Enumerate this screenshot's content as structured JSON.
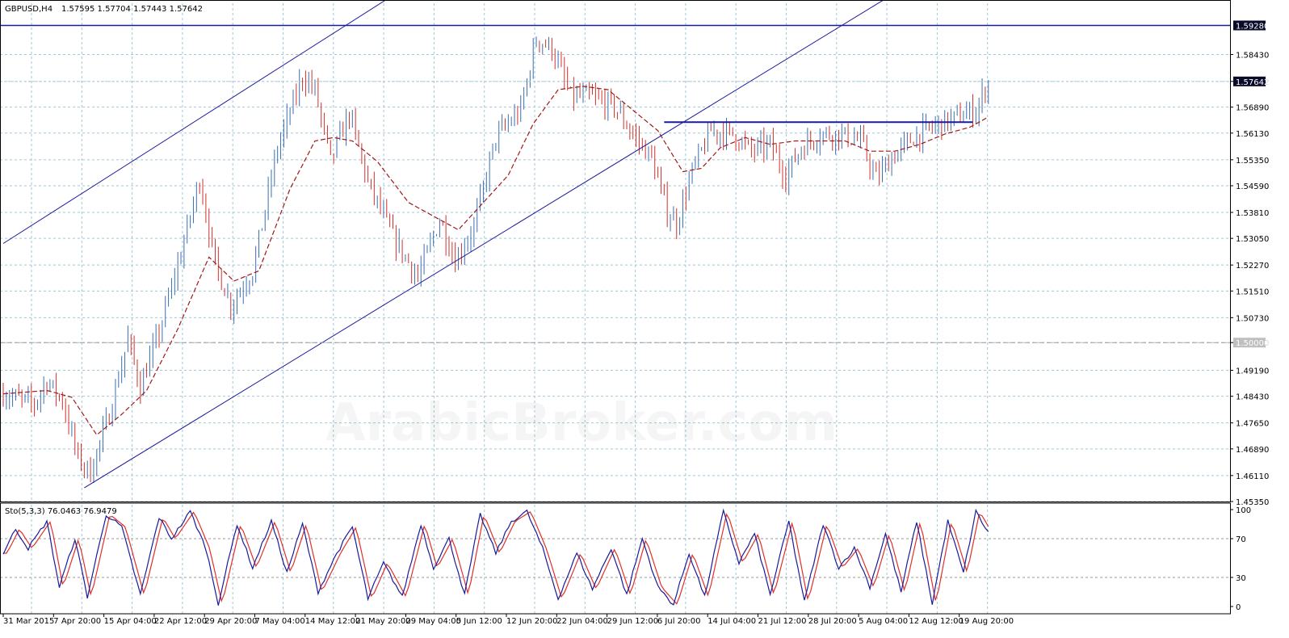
{
  "header": {
    "symbol": "GBPUSD,H4",
    "ohlc": "1.57595 1.57704 1.57443 1.57642"
  },
  "watermark": "ArabicBroker.com",
  "colors": {
    "bull": "#3b6fb0",
    "bear": "#d0312d",
    "ma": "#a01818",
    "trend": "#1a1a9c",
    "grid": "#9fc7d8",
    "stoch_main": "#1a1a9c",
    "stoch_signal": "#e0302a",
    "axis_tag_bg": "#0a0a2a",
    "axis_tag_text": "#ffffff"
  },
  "stochastic": {
    "label": "Sto(5,3,3) 76.0463 76.9479",
    "levels": [
      "100",
      "70",
      "30",
      "0"
    ]
  },
  "chart_data": {
    "type": "candlestick",
    "timeframe": "H4",
    "price_axis_labels": [
      "1.58430",
      "1.57642",
      "1.56890",
      "1.56130",
      "1.55350",
      "1.54590",
      "1.53810",
      "1.53050",
      "1.52270",
      "1.51510",
      "1.50730",
      "1.50000",
      "1.49190",
      "1.48430",
      "1.47650",
      "1.46890",
      "1.46110",
      "1.45350"
    ],
    "price_range": [
      1.4535,
      1.5993
    ],
    "time_axis_labels": [
      "31 Mar 2015",
      "7 Apr 20:00",
      "15 Apr 04:00",
      "22 Apr 12:00",
      "29 Apr 20:00",
      "7 May 04:00",
      "14 May 12:00",
      "21 May 20:00",
      "29 May 04:00",
      "5 Jun 12:00",
      "12 Jun 20:00",
      "22 Jun 04:00",
      "29 Jun 12:00",
      "6 Jul 20:00",
      "14 Jul 04:00",
      "21 Jul 12:00",
      "28 Jul 20:00",
      "5 Aug 04:00",
      "12 Aug 12:00",
      "19 Aug 20:00"
    ],
    "horizontal_levels": [
      {
        "value": 1.5928,
        "label": "1.59280"
      },
      {
        "value": 1.5,
        "label": "1.50000"
      },
      {
        "value": 1.57642,
        "label": "1.57642"
      }
    ],
    "resistance_segment": {
      "from_bar": 212,
      "to_bar": 311,
      "value": 1.5645
    },
    "channel_upper": [
      {
        "bar": 0,
        "value": 1.529
      },
      {
        "bar": 130,
        "value": 1.6045
      }
    ],
    "channel_lower": [
      {
        "bar": 26,
        "value": 1.4575
      },
      {
        "bar": 290,
        "value": 1.6045
      }
    ],
    "price_path": [
      {
        "bar": 0,
        "price": 1.485
      },
      {
        "bar": 10,
        "price": 1.482
      },
      {
        "bar": 14,
        "price": 1.489
      },
      {
        "bar": 19,
        "price": 1.483
      },
      {
        "bar": 24,
        "price": 1.466
      },
      {
        "bar": 28,
        "price": 1.462
      },
      {
        "bar": 34,
        "price": 1.479
      },
      {
        "bar": 40,
        "price": 1.501
      },
      {
        "bar": 44,
        "price": 1.487
      },
      {
        "bar": 50,
        "price": 1.503
      },
      {
        "bar": 57,
        "price": 1.526
      },
      {
        "bar": 63,
        "price": 1.548
      },
      {
        "bar": 68,
        "price": 1.523
      },
      {
        "bar": 73,
        "price": 1.511
      },
      {
        "bar": 80,
        "price": 1.521
      },
      {
        "bar": 88,
        "price": 1.557
      },
      {
        "bar": 96,
        "price": 1.578
      },
      {
        "bar": 100,
        "price": 1.574
      },
      {
        "bar": 105,
        "price": 1.553
      },
      {
        "bar": 111,
        "price": 1.567
      },
      {
        "bar": 117,
        "price": 1.547
      },
      {
        "bar": 125,
        "price": 1.531
      },
      {
        "bar": 133,
        "price": 1.519
      },
      {
        "bar": 140,
        "price": 1.536
      },
      {
        "bar": 145,
        "price": 1.524
      },
      {
        "bar": 151,
        "price": 1.534
      },
      {
        "bar": 158,
        "price": 1.56
      },
      {
        "bar": 166,
        "price": 1.568
      },
      {
        "bar": 171,
        "price": 1.589
      },
      {
        "bar": 176,
        "price": 1.586
      },
      {
        "bar": 182,
        "price": 1.572
      },
      {
        "bar": 188,
        "price": 1.572
      },
      {
        "bar": 196,
        "price": 1.569
      },
      {
        "bar": 202,
        "price": 1.561
      },
      {
        "bar": 208,
        "price": 1.554
      },
      {
        "bar": 213,
        "price": 1.538
      },
      {
        "bar": 216,
        "price": 1.535
      },
      {
        "bar": 221,
        "price": 1.55
      },
      {
        "bar": 227,
        "price": 1.562
      },
      {
        "bar": 234,
        "price": 1.561
      },
      {
        "bar": 240,
        "price": 1.556
      },
      {
        "bar": 246,
        "price": 1.558
      },
      {
        "bar": 251,
        "price": 1.549
      },
      {
        "bar": 256,
        "price": 1.557
      },
      {
        "bar": 262,
        "price": 1.561
      },
      {
        "bar": 268,
        "price": 1.561
      },
      {
        "bar": 275,
        "price": 1.559
      },
      {
        "bar": 280,
        "price": 1.548
      },
      {
        "bar": 285,
        "price": 1.554
      },
      {
        "bar": 292,
        "price": 1.56
      },
      {
        "bar": 300,
        "price": 1.564
      },
      {
        "bar": 306,
        "price": 1.566
      },
      {
        "bar": 312,
        "price": 1.568
      },
      {
        "bar": 316,
        "price": 1.5764
      }
    ],
    "moving_average_path": [
      {
        "bar": 0,
        "value": 1.485
      },
      {
        "bar": 14,
        "value": 1.486
      },
      {
        "bar": 22,
        "value": 1.484
      },
      {
        "bar": 30,
        "value": 1.473
      },
      {
        "bar": 38,
        "value": 1.479
      },
      {
        "bar": 46,
        "value": 1.486
      },
      {
        "bar": 56,
        "value": 1.504
      },
      {
        "bar": 66,
        "value": 1.525
      },
      {
        "bar": 74,
        "value": 1.518
      },
      {
        "bar": 82,
        "value": 1.521
      },
      {
        "bar": 92,
        "value": 1.545
      },
      {
        "bar": 100,
        "value": 1.559
      },
      {
        "bar": 106,
        "value": 1.56
      },
      {
        "bar": 112,
        "value": 1.559
      },
      {
        "bar": 120,
        "value": 1.553
      },
      {
        "bar": 130,
        "value": 1.541
      },
      {
        "bar": 138,
        "value": 1.537
      },
      {
        "bar": 146,
        "value": 1.533
      },
      {
        "bar": 154,
        "value": 1.541
      },
      {
        "bar": 162,
        "value": 1.549
      },
      {
        "bar": 170,
        "value": 1.564
      },
      {
        "bar": 178,
        "value": 1.574
      },
      {
        "bar": 186,
        "value": 1.575
      },
      {
        "bar": 194,
        "value": 1.574
      },
      {
        "bar": 202,
        "value": 1.568
      },
      {
        "bar": 210,
        "value": 1.562
      },
      {
        "bar": 218,
        "value": 1.55
      },
      {
        "bar": 224,
        "value": 1.551
      },
      {
        "bar": 230,
        "value": 1.557
      },
      {
        "bar": 238,
        "value": 1.56
      },
      {
        "bar": 246,
        "value": 1.558
      },
      {
        "bar": 254,
        "value": 1.559
      },
      {
        "bar": 262,
        "value": 1.559
      },
      {
        "bar": 270,
        "value": 1.559
      },
      {
        "bar": 278,
        "value": 1.556
      },
      {
        "bar": 286,
        "value": 1.556
      },
      {
        "bar": 294,
        "value": 1.558
      },
      {
        "bar": 302,
        "value": 1.561
      },
      {
        "bar": 310,
        "value": 1.563
      },
      {
        "bar": 316,
        "value": 1.566
      }
    ],
    "stochastic_pivots": [
      {
        "bar": 0,
        "value": 55
      },
      {
        "bar": 4,
        "value": 80
      },
      {
        "bar": 8,
        "value": 60
      },
      {
        "bar": 14,
        "value": 88
      },
      {
        "bar": 18,
        "value": 20
      },
      {
        "bar": 23,
        "value": 70
      },
      {
        "bar": 27,
        "value": 10
      },
      {
        "bar": 33,
        "value": 95
      },
      {
        "bar": 38,
        "value": 82
      },
      {
        "bar": 44,
        "value": 12
      },
      {
        "bar": 50,
        "value": 92
      },
      {
        "bar": 54,
        "value": 70
      },
      {
        "bar": 60,
        "value": 98
      },
      {
        "bar": 65,
        "value": 60
      },
      {
        "bar": 69,
        "value": 3
      },
      {
        "bar": 75,
        "value": 85
      },
      {
        "bar": 80,
        "value": 40
      },
      {
        "bar": 86,
        "value": 88
      },
      {
        "bar": 91,
        "value": 35
      },
      {
        "bar": 96,
        "value": 85
      },
      {
        "bar": 101,
        "value": 15
      },
      {
        "bar": 107,
        "value": 55
      },
      {
        "bar": 112,
        "value": 82
      },
      {
        "bar": 117,
        "value": 8
      },
      {
        "bar": 122,
        "value": 45
      },
      {
        "bar": 128,
        "value": 10
      },
      {
        "bar": 134,
        "value": 85
      },
      {
        "bar": 138,
        "value": 40
      },
      {
        "bar": 143,
        "value": 70
      },
      {
        "bar": 148,
        "value": 12
      },
      {
        "bar": 153,
        "value": 95
      },
      {
        "bar": 158,
        "value": 55
      },
      {
        "bar": 163,
        "value": 88
      },
      {
        "bar": 168,
        "value": 98
      },
      {
        "bar": 173,
        "value": 60
      },
      {
        "bar": 178,
        "value": 8
      },
      {
        "bar": 184,
        "value": 55
      },
      {
        "bar": 189,
        "value": 18
      },
      {
        "bar": 195,
        "value": 60
      },
      {
        "bar": 200,
        "value": 12
      },
      {
        "bar": 205,
        "value": 70
      },
      {
        "bar": 210,
        "value": 20
      },
      {
        "bar": 215,
        "value": 2
      },
      {
        "bar": 220,
        "value": 55
      },
      {
        "bar": 225,
        "value": 10
      },
      {
        "bar": 231,
        "value": 98
      },
      {
        "bar": 236,
        "value": 45
      },
      {
        "bar": 241,
        "value": 75
      },
      {
        "bar": 246,
        "value": 12
      },
      {
        "bar": 252,
        "value": 88
      },
      {
        "bar": 257,
        "value": 5
      },
      {
        "bar": 263,
        "value": 85
      },
      {
        "bar": 268,
        "value": 40
      },
      {
        "bar": 273,
        "value": 60
      },
      {
        "bar": 278,
        "value": 20
      },
      {
        "bar": 283,
        "value": 75
      },
      {
        "bar": 288,
        "value": 15
      },
      {
        "bar": 293,
        "value": 88
      },
      {
        "bar": 298,
        "value": 3
      },
      {
        "bar": 303,
        "value": 88
      },
      {
        "bar": 308,
        "value": 35
      },
      {
        "bar": 312,
        "value": 98
      },
      {
        "bar": 316,
        "value": 76
      }
    ]
  }
}
